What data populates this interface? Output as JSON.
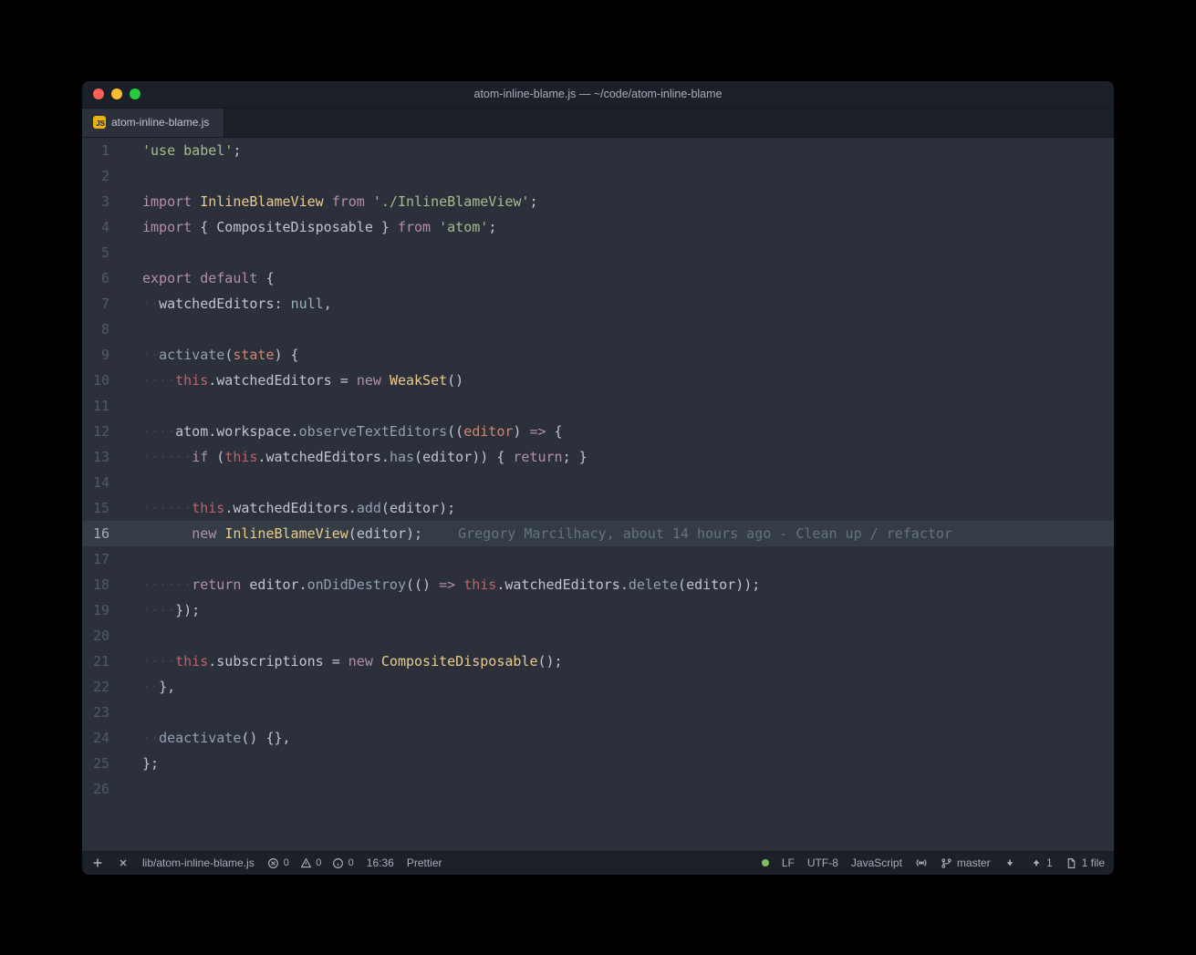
{
  "window": {
    "title": "atom-inline-blame.js — ~/code/atom-inline-blame"
  },
  "tab": {
    "icon_label": "JS",
    "label": "atom-inline-blame.js"
  },
  "editor": {
    "active_line": 16,
    "total_lines": 26,
    "lines": {
      "1": [
        {
          "t": "'use babel'",
          "c": "str"
        },
        {
          "t": ";",
          "c": "pun"
        }
      ],
      "2": [],
      "3": [
        {
          "t": "import",
          "c": "kw"
        },
        {
          "t": " ",
          "c": ""
        },
        {
          "t": "InlineBlameView",
          "c": "cls"
        },
        {
          "t": " ",
          "c": ""
        },
        {
          "t": "from",
          "c": "kw"
        },
        {
          "t": " ",
          "c": ""
        },
        {
          "t": "'./InlineBlameView'",
          "c": "str"
        },
        {
          "t": ";",
          "c": "pun"
        }
      ],
      "4": [
        {
          "t": "import",
          "c": "kw"
        },
        {
          "t": " { ",
          "c": "pun"
        },
        {
          "t": "CompositeDisposable",
          "c": "prop"
        },
        {
          "t": " } ",
          "c": "pun"
        },
        {
          "t": "from",
          "c": "kw"
        },
        {
          "t": " ",
          "c": ""
        },
        {
          "t": "'atom'",
          "c": "str"
        },
        {
          "t": ";",
          "c": "pun"
        }
      ],
      "5": [],
      "6": [
        {
          "t": "export",
          "c": "kw"
        },
        {
          "t": " ",
          "c": ""
        },
        {
          "t": "default",
          "c": "kw"
        },
        {
          "t": " {",
          "c": "pun"
        }
      ],
      "7": [
        {
          "t": "  ",
          "c": "indent"
        },
        {
          "t": "watchedEditors",
          "c": "prop"
        },
        {
          "t": ":",
          "c": "pun"
        },
        {
          "t": " ",
          "c": ""
        },
        {
          "t": "null",
          "c": "c1"
        },
        {
          "t": ",",
          "c": "pun"
        }
      ],
      "8": [],
      "9": [
        {
          "t": "  ",
          "c": "indent"
        },
        {
          "t": "activate",
          "c": "fn"
        },
        {
          "t": "(",
          "c": "pun"
        },
        {
          "t": "state",
          "c": "par"
        },
        {
          "t": ") {",
          "c": "pun"
        }
      ],
      "10": [
        {
          "t": "    ",
          "c": "indent"
        },
        {
          "t": "this",
          "c": "var"
        },
        {
          "t": ".",
          "c": "pun"
        },
        {
          "t": "watchedEditors",
          "c": "prop"
        },
        {
          "t": " = ",
          "c": "pun"
        },
        {
          "t": "new",
          "c": "kw"
        },
        {
          "t": " ",
          "c": ""
        },
        {
          "t": "WeakSet",
          "c": "cls"
        },
        {
          "t": "()",
          "c": "pun"
        }
      ],
      "11": [],
      "12": [
        {
          "t": "    ",
          "c": "indent"
        },
        {
          "t": "atom",
          "c": "prop"
        },
        {
          "t": ".",
          "c": "pun"
        },
        {
          "t": "workspace",
          "c": "prop"
        },
        {
          "t": ".",
          "c": "pun"
        },
        {
          "t": "observeTextEditors",
          "c": "fn"
        },
        {
          "t": "((",
          "c": "pun"
        },
        {
          "t": "editor",
          "c": "par"
        },
        {
          "t": ") ",
          "c": "pun"
        },
        {
          "t": "=>",
          "c": "arrow"
        },
        {
          "t": " {",
          "c": "pun"
        }
      ],
      "13": [
        {
          "t": "      ",
          "c": "indent"
        },
        {
          "t": "if",
          "c": "kw"
        },
        {
          "t": " (",
          "c": "pun"
        },
        {
          "t": "this",
          "c": "var"
        },
        {
          "t": ".",
          "c": "pun"
        },
        {
          "t": "watchedEditors",
          "c": "prop"
        },
        {
          "t": ".",
          "c": "pun"
        },
        {
          "t": "has",
          "c": "fn"
        },
        {
          "t": "(",
          "c": "pun"
        },
        {
          "t": "editor",
          "c": "prop"
        },
        {
          "t": ")) { ",
          "c": "pun"
        },
        {
          "t": "return",
          "c": "kw"
        },
        {
          "t": "; }",
          "c": "pun"
        }
      ],
      "14": [],
      "15": [
        {
          "t": "      ",
          "c": "indent"
        },
        {
          "t": "this",
          "c": "var"
        },
        {
          "t": ".",
          "c": "pun"
        },
        {
          "t": "watchedEditors",
          "c": "prop"
        },
        {
          "t": ".",
          "c": "pun"
        },
        {
          "t": "add",
          "c": "fn"
        },
        {
          "t": "(",
          "c": "pun"
        },
        {
          "t": "editor",
          "c": "prop"
        },
        {
          "t": ");",
          "c": "pun"
        }
      ],
      "16": [
        {
          "t": "      ",
          "c": "indent"
        },
        {
          "t": "new",
          "c": "kw"
        },
        {
          "t": " ",
          "c": ""
        },
        {
          "t": "InlineBlameView",
          "c": "cls"
        },
        {
          "t": "(",
          "c": "pun"
        },
        {
          "t": "editor",
          "c": "prop"
        },
        {
          "t": ");",
          "c": "pun"
        }
      ],
      "17": [],
      "18": [
        {
          "t": "      ",
          "c": "indent"
        },
        {
          "t": "return",
          "c": "kw"
        },
        {
          "t": " ",
          "c": ""
        },
        {
          "t": "editor",
          "c": "prop"
        },
        {
          "t": ".",
          "c": "pun"
        },
        {
          "t": "onDidDestroy",
          "c": "fn"
        },
        {
          "t": "(() ",
          "c": "pun"
        },
        {
          "t": "=>",
          "c": "arrow"
        },
        {
          "t": " ",
          "c": ""
        },
        {
          "t": "this",
          "c": "var"
        },
        {
          "t": ".",
          "c": "pun"
        },
        {
          "t": "watchedEditors",
          "c": "prop"
        },
        {
          "t": ".",
          "c": "pun"
        },
        {
          "t": "delete",
          "c": "fn"
        },
        {
          "t": "(",
          "c": "pun"
        },
        {
          "t": "editor",
          "c": "prop"
        },
        {
          "t": "));",
          "c": "pun"
        }
      ],
      "19": [
        {
          "t": "    ",
          "c": "indent"
        },
        {
          "t": "});",
          "c": "pun"
        }
      ],
      "20": [],
      "21": [
        {
          "t": "    ",
          "c": "indent"
        },
        {
          "t": "this",
          "c": "var"
        },
        {
          "t": ".",
          "c": "pun"
        },
        {
          "t": "subscriptions",
          "c": "prop"
        },
        {
          "t": " = ",
          "c": "pun"
        },
        {
          "t": "new",
          "c": "kw"
        },
        {
          "t": " ",
          "c": ""
        },
        {
          "t": "CompositeDisposable",
          "c": "cls"
        },
        {
          "t": "();",
          "c": "pun"
        }
      ],
      "22": [
        {
          "t": "  ",
          "c": "indent"
        },
        {
          "t": "},",
          "c": "pun"
        }
      ],
      "23": [],
      "24": [
        {
          "t": "  ",
          "c": "indent"
        },
        {
          "t": "deactivate",
          "c": "fn"
        },
        {
          "t": "() {},",
          "c": "pun"
        }
      ],
      "25": [
        {
          "t": "};",
          "c": "pun"
        }
      ],
      "26": []
    },
    "blame": {
      "line": 16,
      "text": "Gregory Marcilhacy, about 14 hours ago - Clean up / refactor"
    }
  },
  "status": {
    "path": "lib/atom-inline-blame.js",
    "diagnostics": {
      "errors": "0",
      "warnings": "0",
      "info": "0"
    },
    "cursor": "16:36",
    "prettier": "Prettier",
    "line_ending": "LF",
    "encoding": "UTF-8",
    "grammar": "JavaScript",
    "branch": "master",
    "git_down": "",
    "git_up": "1",
    "files": "1 file"
  }
}
